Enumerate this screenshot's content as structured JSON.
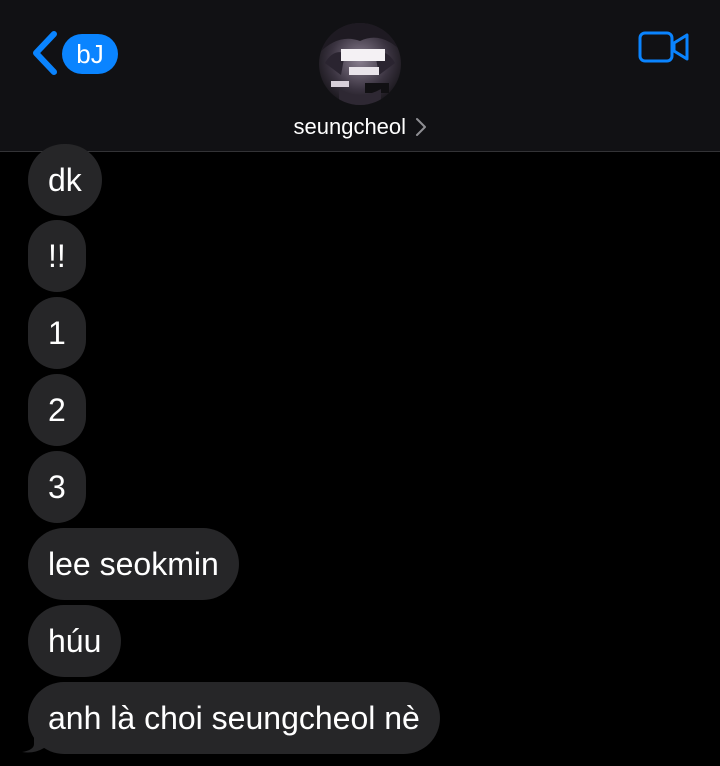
{
  "header": {
    "back_badge": "bJ",
    "contact_name": "seungcheol",
    "accent_color": "#0a84ff"
  },
  "messages": [
    {
      "text": "dk"
    },
    {
      "text": "!!"
    },
    {
      "text": "1"
    },
    {
      "text": "2"
    },
    {
      "text": "3"
    },
    {
      "text": "lee seokmin"
    },
    {
      "text": "húu"
    },
    {
      "text": "anh là choi seungcheol nè"
    }
  ],
  "icons": {
    "back": "chevron-left-icon",
    "video": "video-camera-icon",
    "name_disclosure": "chevron-right-icon"
  }
}
